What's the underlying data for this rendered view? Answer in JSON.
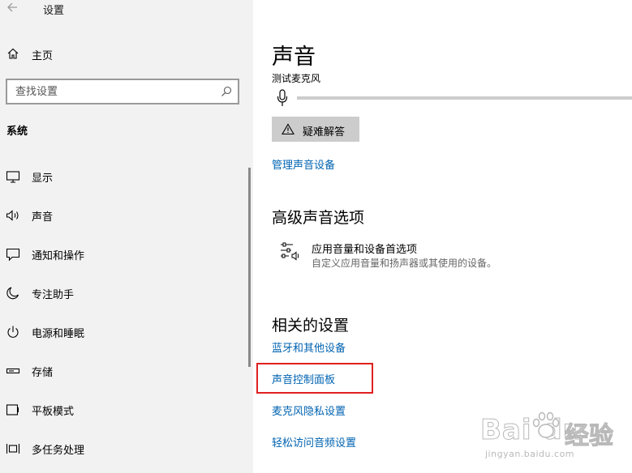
{
  "window": {
    "title": "设置"
  },
  "sidebar": {
    "home_label": "主页",
    "search_placeholder": "查找设置",
    "section_label": "系统",
    "items": [
      {
        "label": "显示",
        "icon": "monitor-icon"
      },
      {
        "label": "声音",
        "icon": "speaker-icon"
      },
      {
        "label": "通知和操作",
        "icon": "notification-icon"
      },
      {
        "label": "专注助手",
        "icon": "moon-icon"
      },
      {
        "label": "电源和睡眠",
        "icon": "power-icon"
      },
      {
        "label": "存储",
        "icon": "storage-icon"
      },
      {
        "label": "平板模式",
        "icon": "tablet-icon"
      },
      {
        "label": "多任务处理",
        "icon": "multitask-icon"
      }
    ]
  },
  "main": {
    "title": "声音",
    "mic_test_label": "测试麦克风",
    "troubleshoot_label": "疑难解答",
    "manage_devices_link": "管理声音设备",
    "advanced_heading": "高级声音选项",
    "advanced_item": {
      "title": "应用音量和设备首选项",
      "description": "自定义应用音量和扬声器或其使用的设备。"
    },
    "related_heading": "相关的设置",
    "related_links": [
      "蓝牙和其他设备",
      "声音控制面板",
      "麦克风隐私设置",
      "轻松访问音频设置"
    ]
  },
  "colors": {
    "link": "#0063b1",
    "sidebar_bg": "#f2f2f2",
    "highlight": "#e02020"
  },
  "watermark": {
    "logo": "Bai du",
    "cn": "经验",
    "url": "jingyan.baidu.com"
  }
}
